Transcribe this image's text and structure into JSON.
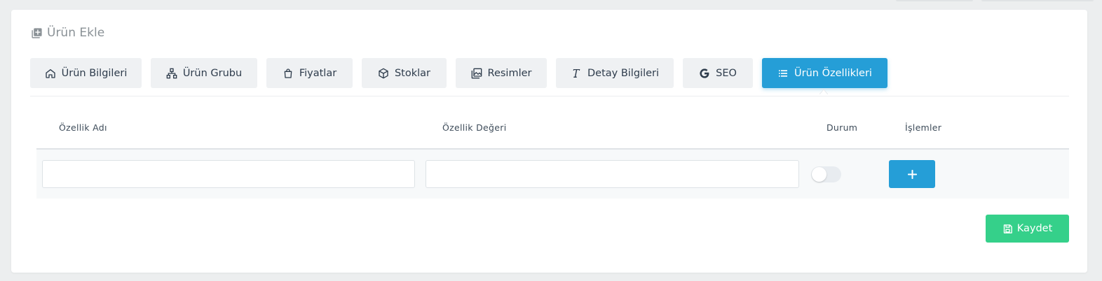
{
  "page": {
    "title": "Ürün Ekle",
    "title_icon": "add-box-icon"
  },
  "tabs": [
    {
      "label": "Ürün Bilgileri",
      "icon": "home-icon",
      "active": false
    },
    {
      "label": "Ürün Grubu",
      "icon": "sitemap-icon",
      "active": false
    },
    {
      "label": "Fiyatlar",
      "icon": "shopping-bag-icon",
      "active": false
    },
    {
      "label": "Stoklar",
      "icon": "box-icon",
      "active": false
    },
    {
      "label": "Resimler",
      "icon": "images-icon",
      "active": false
    },
    {
      "label": "Detay Bilgileri",
      "icon": "text-icon",
      "active": false
    },
    {
      "label": "SEO",
      "icon": "google-icon",
      "active": false
    },
    {
      "label": "Ürün Özellikleri",
      "icon": "list-icon",
      "active": true
    }
  ],
  "table": {
    "headers": {
      "name": "Özellik Adı",
      "value": "Özellik Değeri",
      "status": "Durum",
      "actions": "İşlemler"
    },
    "row": {
      "name_value": "",
      "name_placeholder": "",
      "value_value": "",
      "value_placeholder": "",
      "status_on": false,
      "add_label": "+"
    }
  },
  "save_button": {
    "label": "Kaydet",
    "icon": "save-icon"
  },
  "colors": {
    "primary": "#259ed7",
    "success": "#35d08a",
    "tab_bg": "#eff1f3",
    "text": "#2e3c4c"
  }
}
